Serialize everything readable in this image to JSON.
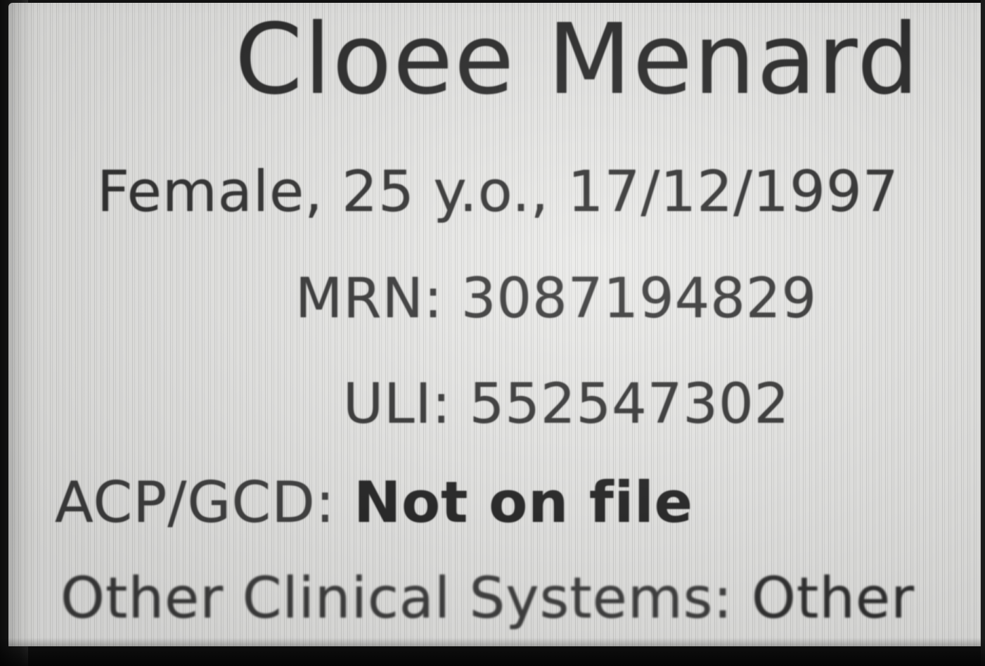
{
  "patient": {
    "name": "Cloee Menard",
    "demographics": "Female, 25 y.o., 17/12/1997",
    "mrn_label": "MRN:",
    "mrn_value": "3087194829",
    "uli_label": "ULI:",
    "uli_value": "552547302",
    "acp_label": "ACP/GCD:",
    "acp_value": "Not on file",
    "other_systems_label": "Other Clinical Systems:",
    "other_systems_value": "Other"
  }
}
